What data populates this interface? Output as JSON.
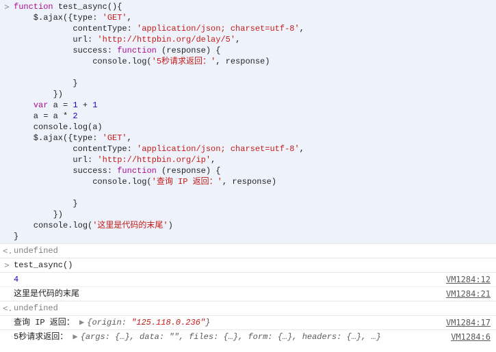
{
  "code_input": {
    "tokens": [
      {
        "t": "function ",
        "c": "kw"
      },
      {
        "t": "test_async",
        "c": "ident"
      },
      {
        "t": "(){",
        "c": "ident"
      },
      {
        "t": "\n",
        "c": ""
      },
      {
        "t": "    $.ajax({type: ",
        "c": "ident"
      },
      {
        "t": "'GET'",
        "c": "str"
      },
      {
        "t": ",",
        "c": "ident"
      },
      {
        "t": "\n",
        "c": ""
      },
      {
        "t": "            contentType: ",
        "c": "ident"
      },
      {
        "t": "'application/json; charset=utf-8'",
        "c": "str"
      },
      {
        "t": ",",
        "c": "ident"
      },
      {
        "t": "\n",
        "c": ""
      },
      {
        "t": "            url: ",
        "c": "ident"
      },
      {
        "t": "'http://httpbin.org/delay/5'",
        "c": "str"
      },
      {
        "t": ",",
        "c": "ident"
      },
      {
        "t": "\n",
        "c": ""
      },
      {
        "t": "            success: ",
        "c": "ident"
      },
      {
        "t": "function ",
        "c": "fn"
      },
      {
        "t": "(response) {",
        "c": "ident"
      },
      {
        "t": "\n",
        "c": ""
      },
      {
        "t": "                console.log(",
        "c": "ident"
      },
      {
        "t": "'5秒请求返回：'",
        "c": "str"
      },
      {
        "t": ", response)",
        "c": "ident"
      },
      {
        "t": "\n",
        "c": ""
      },
      {
        "t": "\n",
        "c": ""
      },
      {
        "t": "            }",
        "c": "ident"
      },
      {
        "t": "\n",
        "c": ""
      },
      {
        "t": "        })",
        "c": "ident"
      },
      {
        "t": "\n",
        "c": ""
      },
      {
        "t": "    ",
        "c": ""
      },
      {
        "t": "var ",
        "c": "kw"
      },
      {
        "t": "a = ",
        "c": "ident"
      },
      {
        "t": "1",
        "c": "num"
      },
      {
        "t": " + ",
        "c": "ident"
      },
      {
        "t": "1",
        "c": "num"
      },
      {
        "t": "\n",
        "c": ""
      },
      {
        "t": "    a = a * ",
        "c": "ident"
      },
      {
        "t": "2",
        "c": "num"
      },
      {
        "t": "\n",
        "c": ""
      },
      {
        "t": "    console.log(a)",
        "c": "ident"
      },
      {
        "t": "\n",
        "c": ""
      },
      {
        "t": "    $.ajax({type: ",
        "c": "ident"
      },
      {
        "t": "'GET'",
        "c": "str"
      },
      {
        "t": ",",
        "c": "ident"
      },
      {
        "t": "\n",
        "c": ""
      },
      {
        "t": "            contentType: ",
        "c": "ident"
      },
      {
        "t": "'application/json; charset=utf-8'",
        "c": "str"
      },
      {
        "t": ",",
        "c": "ident"
      },
      {
        "t": "\n",
        "c": ""
      },
      {
        "t": "            url: ",
        "c": "ident"
      },
      {
        "t": "'http://httpbin.org/ip'",
        "c": "str"
      },
      {
        "t": ",",
        "c": "ident"
      },
      {
        "t": "\n",
        "c": ""
      },
      {
        "t": "            success: ",
        "c": "ident"
      },
      {
        "t": "function ",
        "c": "fn"
      },
      {
        "t": "(response) {",
        "c": "ident"
      },
      {
        "t": "\n",
        "c": ""
      },
      {
        "t": "                console.log(",
        "c": "ident"
      },
      {
        "t": "'查询 IP 返回：'",
        "c": "str"
      },
      {
        "t": ", response)",
        "c": "ident"
      },
      {
        "t": "\n",
        "c": ""
      },
      {
        "t": "\n",
        "c": ""
      },
      {
        "t": "            }",
        "c": "ident"
      },
      {
        "t": "\n",
        "c": ""
      },
      {
        "t": "        })",
        "c": "ident"
      },
      {
        "t": "\n",
        "c": ""
      },
      {
        "t": "    console.log(",
        "c": "ident"
      },
      {
        "t": "'这里是代码的末尾'",
        "c": "str"
      },
      {
        "t": ")",
        "c": "ident"
      },
      {
        "t": "\n",
        "c": ""
      },
      {
        "t": "}",
        "c": "ident"
      }
    ]
  },
  "result1": "undefined",
  "call_input": "test_async()",
  "logs": [
    {
      "text": "4",
      "src": "VM1284:12",
      "cls": "num"
    },
    {
      "text": "这里是代码的末尾",
      "src": "VM1284:21",
      "cls": "ident"
    }
  ],
  "result2": "undefined",
  "log_ip": {
    "prefix": "查询 IP 返回：",
    "origin_label": "origin:",
    "origin_value": "\"125.118.0.236\"",
    "src": "VM1284:17"
  },
  "log_delay": {
    "prefix": "5秒请求返回：",
    "obj": "{args: {…}, data: \"\", files: {…}, form: {…}, headers: {…}, …}",
    "src": "VM1284:6"
  },
  "icons": {
    "input": ">",
    "output": "<.",
    "expand": "▶"
  }
}
